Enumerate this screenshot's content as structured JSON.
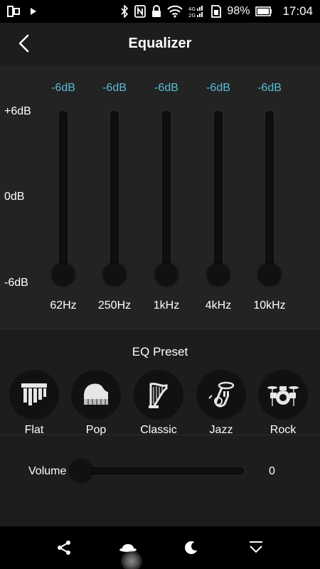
{
  "status_bar": {
    "left_icons": [
      "dual-window-icon",
      "play-icon"
    ],
    "right_icons": [
      "bluetooth-icon",
      "nfc-icon",
      "lock-icon",
      "wifi-icon",
      "cellular-4g-icon",
      "sim-icon"
    ],
    "battery_percent": "98%",
    "time": "17:04"
  },
  "header": {
    "title": "Equalizer",
    "back_icon": "chevron-left-icon"
  },
  "equalizer": {
    "scale": {
      "top": "+6dB",
      "middle": "0dB",
      "bottom": "-6dB"
    },
    "value_color": "#58bcd6",
    "bands": [
      {
        "label": "62Hz",
        "value": "-6dB",
        "gain_db": -6
      },
      {
        "label": "250Hz",
        "value": "-6dB",
        "gain_db": -6
      },
      {
        "label": "1kHz",
        "value": "-6dB",
        "gain_db": -6
      },
      {
        "label": "4kHz",
        "value": "-6dB",
        "gain_db": -6
      },
      {
        "label": "10kHz",
        "value": "-6dB",
        "gain_db": -6
      }
    ],
    "range_db": [
      -6,
      6
    ]
  },
  "presets": {
    "title": "EQ Preset",
    "items": [
      {
        "label": "Flat",
        "icon": "chimes-icon"
      },
      {
        "label": "Pop",
        "icon": "piano-icon"
      },
      {
        "label": "Classic",
        "icon": "harp-icon"
      },
      {
        "label": "Jazz",
        "icon": "tuba-icon"
      },
      {
        "label": "Rock",
        "icon": "drums-icon"
      }
    ]
  },
  "volume": {
    "label": "Volume",
    "value": "0",
    "level": 0
  },
  "bottom_nav": {
    "icons": [
      "share-icon",
      "hat-icon",
      "moon-icon",
      "chevron-down-icon"
    ]
  }
}
